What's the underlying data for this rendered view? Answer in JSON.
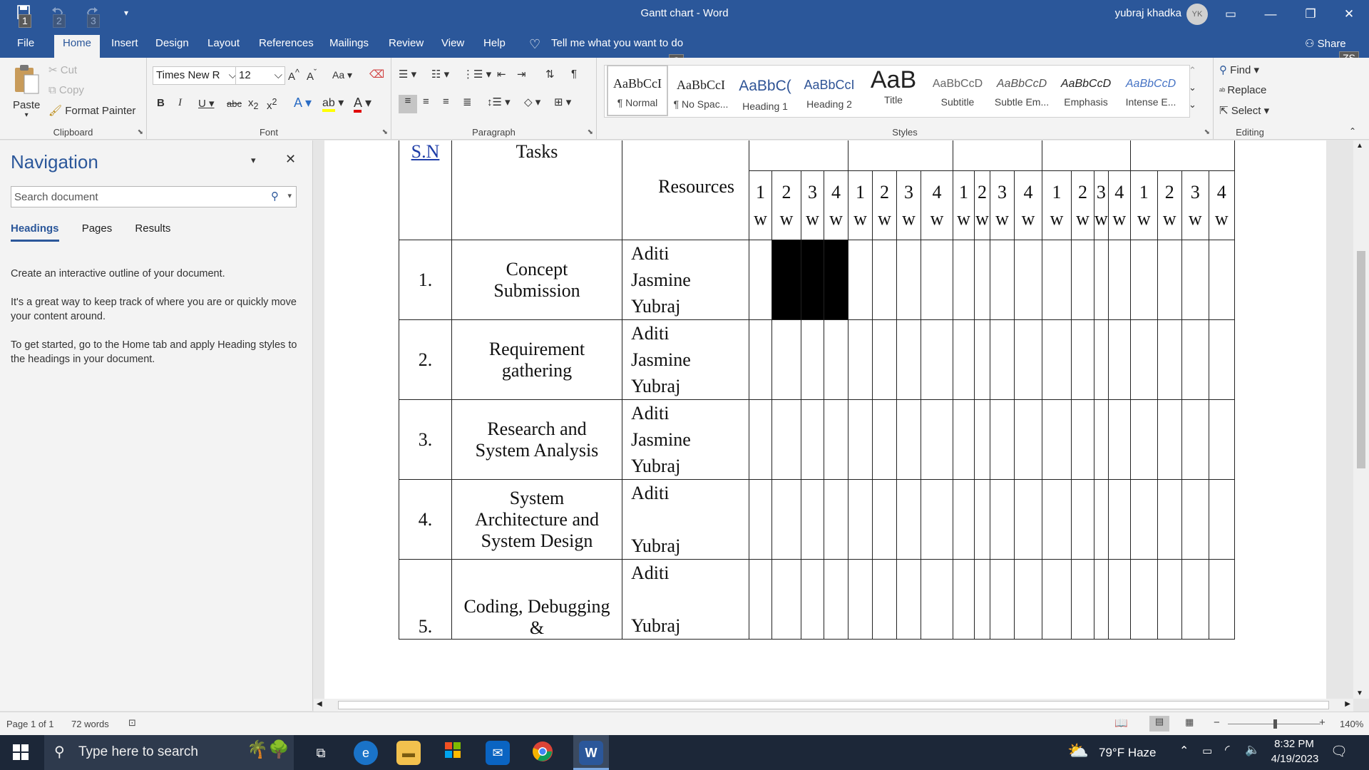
{
  "window": {
    "title": "Gantt chart  -  Word",
    "user": "yubraj khadka",
    "avatar_initials": "YK"
  },
  "qat": [
    {
      "name": "save-icon",
      "key": "1"
    },
    {
      "name": "undo-icon",
      "key": "2"
    },
    {
      "name": "redo-icon",
      "key": "3"
    }
  ],
  "tabs": [
    {
      "label": "File",
      "key": "F"
    },
    {
      "label": "Home",
      "key": "H"
    },
    {
      "label": "Insert",
      "key": "N"
    },
    {
      "label": "Design",
      "key": "G"
    },
    {
      "label": "Layout",
      "key": "P"
    },
    {
      "label": "References",
      "key": "S"
    },
    {
      "label": "Mailings",
      "key": "M"
    },
    {
      "label": "Review",
      "key": "R"
    },
    {
      "label": "View",
      "key": "W"
    },
    {
      "label": "Help",
      "key": "Y"
    }
  ],
  "tell_me": {
    "label": "Tell me what you want to do",
    "key": "Q"
  },
  "share": {
    "label": "Share",
    "key": "ZS"
  },
  "clipboard": {
    "paste": "Paste",
    "cut": "Cut",
    "copy": "Copy",
    "format_painter": "Format Painter",
    "label": "Clipboard"
  },
  "font": {
    "name": "Times New Roman",
    "name_display": "Times New R",
    "size": "12",
    "label": "Font"
  },
  "paragraph": {
    "label": "Paragraph"
  },
  "styles": {
    "label": "Styles",
    "items": [
      {
        "preview": "AaBbCcI",
        "name": "¶ Normal"
      },
      {
        "preview": "AaBbCcI",
        "name": "¶ No Spac..."
      },
      {
        "preview": "AaBbC(",
        "name": "Heading 1"
      },
      {
        "preview": "AaBbCcI",
        "name": "Heading 2"
      },
      {
        "preview": "AaB",
        "name": "Title"
      },
      {
        "preview": "AaBbCcD",
        "name": "Subtitle"
      },
      {
        "preview": "AaBbCcD",
        "name": "Subtle Em..."
      },
      {
        "preview": "AaBbCcD",
        "name": "Emphasis"
      },
      {
        "preview": "AaBbCcD",
        "name": "Intense E..."
      }
    ]
  },
  "editing": {
    "find": "Find",
    "replace": "Replace",
    "select": "Select",
    "label": "Editing"
  },
  "nav": {
    "title": "Navigation",
    "search_placeholder": "Search document",
    "tabs": [
      "Headings",
      "Pages",
      "Results"
    ],
    "help": [
      "Create an interactive outline of your document.",
      "It's a great way to keep track of where you are or quickly move your content around.",
      "To get started, go to the Home tab and apply Heading styles to the headings in your document."
    ]
  },
  "table": {
    "headers": {
      "sn": "S.N",
      "tasks": "Tasks",
      "resources": "Resources"
    },
    "week_nums": [
      "1",
      "2",
      "3",
      "4",
      "1",
      "2",
      "3",
      "4",
      "1",
      "2",
      "3",
      "4",
      "1",
      "2",
      "3",
      "4",
      "1",
      "2",
      "3",
      "4"
    ],
    "week_unit": "w",
    "rows": [
      {
        "sn": "1.",
        "task": "Concept Submission",
        "resources": [
          "Aditi",
          "Jasmine",
          "Yubraj"
        ]
      },
      {
        "sn": "2.",
        "task": "Requirement gathering",
        "resources": [
          "Aditi",
          "Jasmine",
          "Yubraj"
        ]
      },
      {
        "sn": "3.",
        "task": "Research and System Analysis",
        "resources": [
          "Aditi",
          "Jasmine",
          "Yubraj"
        ]
      },
      {
        "sn": "4.",
        "task": "System Architecture and System Design",
        "resources": [
          "Aditi",
          "",
          "Yubraj"
        ]
      },
      {
        "sn": "5.",
        "task": "Coding, Debugging &",
        "resources": [
          "Aditi",
          "",
          "Yubraj"
        ]
      }
    ],
    "bars": [
      {
        "row": 0,
        "from_week": 2,
        "to_week": 4,
        "color": "#000000"
      }
    ]
  },
  "status": {
    "page": "Page 1 of 1",
    "words": "72 words",
    "zoom": "140%"
  },
  "taskbar": {
    "search_placeholder": "Type here to search",
    "weather": "79°F  Haze",
    "time": "8:32 PM",
    "date": "4/19/2023"
  },
  "colors": {
    "accent": "#2b579a",
    "taskbar": "#1c2738"
  }
}
